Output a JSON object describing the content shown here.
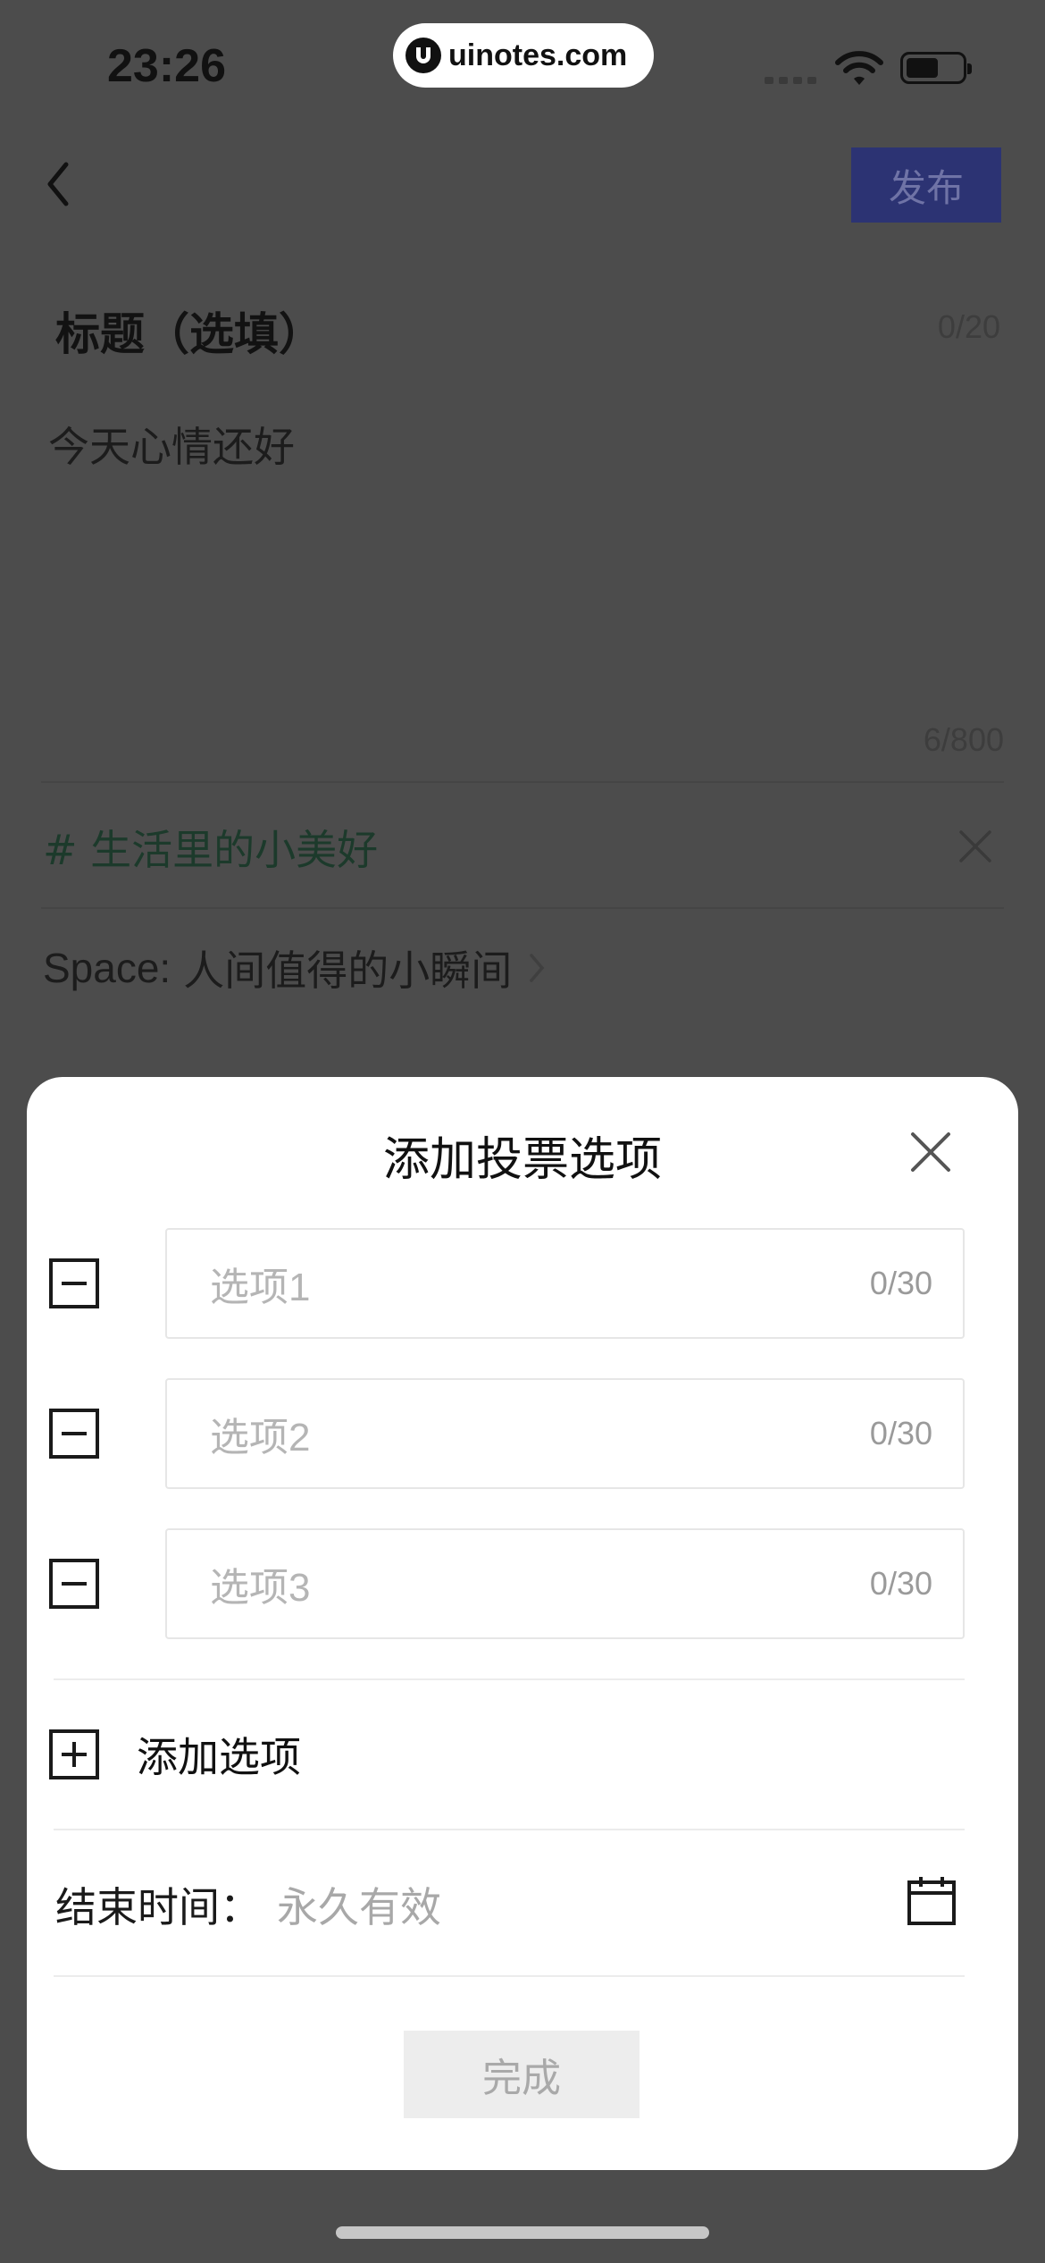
{
  "status_bar": {
    "time": "23:26",
    "watermark": "uinotes.com"
  },
  "header": {
    "publish_label": "发布"
  },
  "post": {
    "title_placeholder": "标题（选填）",
    "title_count": "0/20",
    "body": "今天心情还好",
    "body_count": "6/800",
    "topic": "# 生活里的小美好",
    "space_prefix": "Space:",
    "space_name": "人间值得的小瞬间"
  },
  "poll_modal": {
    "title": "添加投票选项",
    "options": [
      {
        "placeholder": "选项1",
        "count": "0/30"
      },
      {
        "placeholder": "选项2",
        "count": "0/30"
      },
      {
        "placeholder": "选项3",
        "count": "0/30"
      }
    ],
    "add_option_label": "添加选项",
    "end_time_label": "结束时间：",
    "end_time_value": "永久有效",
    "done_label": "完成"
  },
  "icons": [
    "back-chevron-icon",
    "close-icon",
    "minus-icon",
    "plus-icon",
    "calendar-icon",
    "chevron-right-icon",
    "wifi-icon",
    "battery-icon"
  ],
  "colors": {
    "overlay": "#4c4c4c",
    "publish_bg": "#2c3373",
    "topic_text": "#1c3a2b",
    "modal_bg": "#ffffff"
  }
}
